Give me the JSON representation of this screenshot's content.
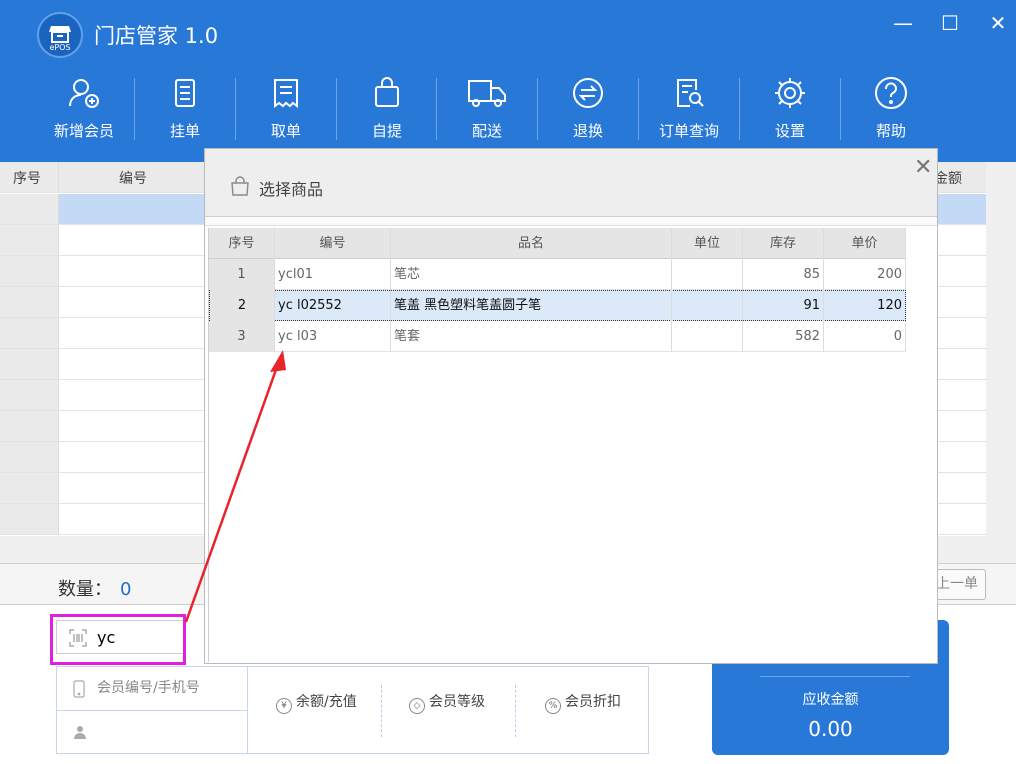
{
  "app": {
    "title": "门店管家 1.0",
    "logo_text": "ePOS"
  },
  "window_controls": {
    "minimize": "—",
    "maximize": "☐",
    "close": "✕"
  },
  "toolbar": [
    {
      "label": "新增会员",
      "icon": "add-member-icon"
    },
    {
      "label": "挂单",
      "icon": "hold-order-icon"
    },
    {
      "label": "取单",
      "icon": "retrieve-order-icon"
    },
    {
      "label": "自提",
      "icon": "pickup-bag-icon"
    },
    {
      "label": "配送",
      "icon": "delivery-truck-icon"
    },
    {
      "label": "退换",
      "icon": "exchange-icon"
    },
    {
      "label": "订单查询",
      "icon": "order-search-icon"
    },
    {
      "label": "设置",
      "icon": "gear-icon"
    },
    {
      "label": "帮助",
      "icon": "help-icon"
    }
  ],
  "main_grid": {
    "columns": [
      "序号",
      "编号",
      "金额"
    ]
  },
  "bottom": {
    "qty_label": "数量：",
    "qty_value": "0",
    "prev_order_label": "上一单",
    "scan_value": "yc",
    "member_placeholder": "会员编号/手机号",
    "member_buttons": [
      "余额/充值",
      "会员等级",
      "会员折扣"
    ],
    "total_label": "应收金额",
    "total_value": "0.00"
  },
  "dialog": {
    "title": "选择商品",
    "close": "✕",
    "columns": [
      "序号",
      "编号",
      "品名",
      "单位",
      "库存",
      "单价"
    ],
    "rows": [
      {
        "no": "1",
        "code": "ycl01",
        "name": "笔芯",
        "unit": "",
        "stock": "85",
        "price": "200"
      },
      {
        "no": "2",
        "code": "yc l02552",
        "name": "笔盖  黑色塑料笔盖圆子笔",
        "unit": "",
        "stock": "91",
        "price": "120"
      },
      {
        "no": "3",
        "code": "yc l03",
        "name": "笔套",
        "unit": "",
        "stock": "582",
        "price": "0"
      }
    ],
    "selected_row": 2
  },
  "colors": {
    "primary": "#2878d8",
    "highlight": "#e020e0",
    "arrow": "#e8232a"
  }
}
